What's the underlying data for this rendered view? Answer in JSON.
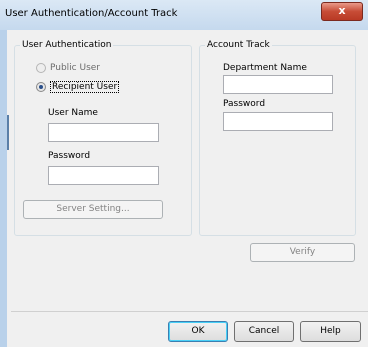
{
  "window": {
    "title": "User Authentication/Account Track",
    "close_label": "x"
  },
  "user_auth": {
    "title": "User Authentication",
    "public_user": "Public User",
    "recipient_user": "Recipient User",
    "selected": "recipient_user",
    "user_name_label": "User Name",
    "user_name_value": "",
    "password_label": "Password",
    "password_value": "",
    "server_setting_label": "Server Setting..."
  },
  "account_track": {
    "title": "Account Track",
    "department_name_label": "Department Name",
    "department_name_value": "",
    "password_label": "Password",
    "password_value": ""
  },
  "buttons": {
    "verify": "Verify",
    "ok": "OK",
    "cancel": "Cancel",
    "help": "Help"
  }
}
